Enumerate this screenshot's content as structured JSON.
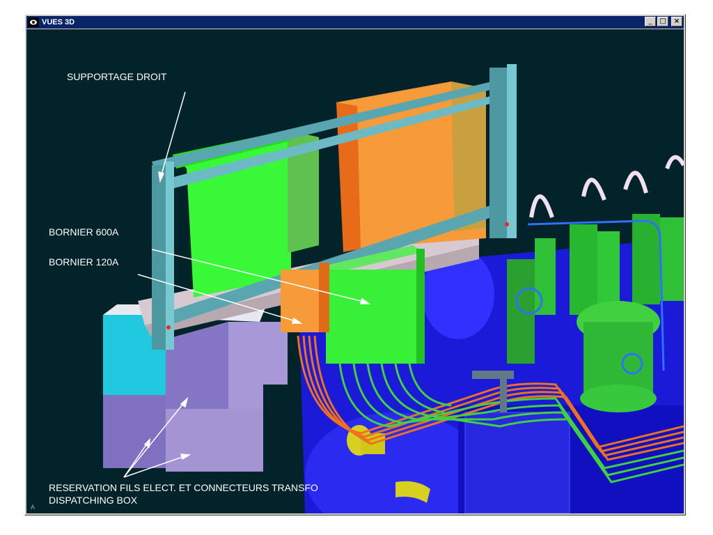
{
  "window": {
    "title": "VUES 3D",
    "minimize": "_",
    "maximize": "□",
    "close": "×"
  },
  "labels": {
    "supportage_droit": "SUPPORTAGE DROIT",
    "bornier_600a": "BORNIER 600A",
    "bornier_120a": "BORNIER 120A",
    "reservation_line1": "RESERVATION FILS ELECT. ET CONNECTEURS TRANSFO",
    "reservation_line2": "DISPATCHING BOX"
  },
  "axis_marker": "A",
  "icons": {
    "app": "eye-icon"
  },
  "colors": {
    "viewport_bg": "#03232a",
    "frame": "#5aa6b0",
    "green": "#33ee33",
    "orange": "#f79a3a",
    "blue": "#2020e8",
    "cyan": "#20c8e0",
    "lavender": "#a89ad8"
  }
}
